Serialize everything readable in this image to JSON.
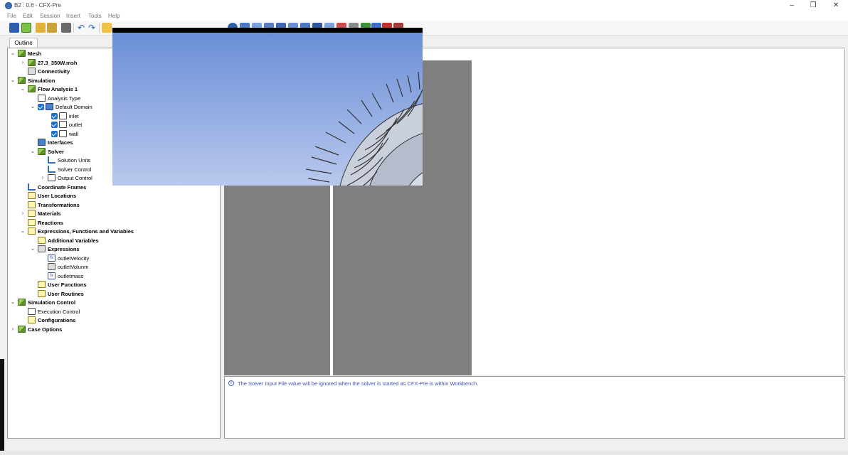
{
  "window": {
    "title": "B2 : 0.6 - CFX-Pre",
    "min_icon": "minimize-icon",
    "max_icon": "maximize-icon",
    "close_icon": "close-icon"
  },
  "menu": [
    "File",
    "Edit",
    "Session",
    "Insert",
    "Tools",
    "Help"
  ],
  "outline_tab": "Outline",
  "tree": {
    "mesh": "Mesh",
    "mesh_file": "27.3_350W.msh",
    "connectivity": "Connectivity",
    "simulation": "Simulation",
    "flow_analysis": "Flow Analysis 1",
    "analysis_type": "Analysis Type",
    "default_domain": "Default Domain",
    "inlet": "inlet",
    "outlet": "outlet",
    "wall": "wall",
    "interfaces": "Interfaces",
    "solver": "Solver",
    "solution_units": "Solution Units",
    "solver_control": "Solver Control",
    "output_control": "Output Control",
    "coordinate_frames": "Coordinate Frames",
    "user_locations": "User Locations",
    "transformations": "Transformations",
    "materials": "Materials",
    "reactions": "Reactions",
    "efv": "Expressions, Functions and Variables",
    "additional_variables": "Additional Variables",
    "expressions": "Expressions",
    "outlet_velocity": "outletVelocity",
    "outlet_volunm": "outletVolunm",
    "outletmass": "outletmass",
    "user_functions": "User Functions",
    "user_routines": "User Routines",
    "simulation_control": "Simulation Control",
    "execution_control": "Execution Control",
    "configurations": "Configurations",
    "case_options": "Case Options"
  },
  "message": "The Solver Input File value will be ignored when the solver is started as CFX-Pre is within Workbench.",
  "colors": {
    "accent": "#1d70c9",
    "message_text": "#3a4fb5",
    "viewport_grey": "#7f7f7f"
  }
}
